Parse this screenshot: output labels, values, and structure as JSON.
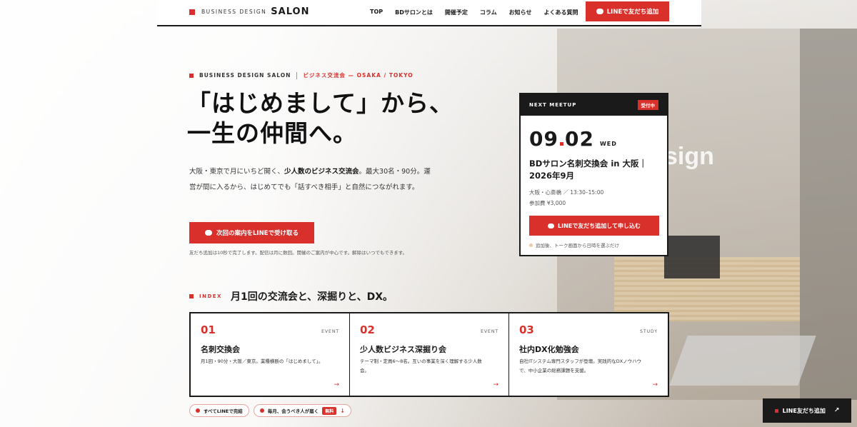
{
  "header": {
    "logo_prefix": "BUSINESS DESIGN",
    "logo_main": "SALON",
    "nav": [
      "TOP",
      "BDサロンとは",
      "開催予定",
      "コラム",
      "お知らせ",
      "よくある質問"
    ],
    "line_button": "LINEで友だち追加"
  },
  "hero": {
    "eyebrow_brand": "BUSINESS DESIGN SALON",
    "eyebrow_tag": "ビジネス交流会 — OSAKA / TOKYO",
    "title_line1": "「はじめまして」から、",
    "title_line2": "一生の仲間へ。",
    "lead_1": "大阪・東京で月にいちど開く、",
    "lead_bold": "少人数のビジネス交流会",
    "lead_2": "。最大30名・90分。運営が間に入るから、はじめてでも「話すべき相手」と自然につながれます。",
    "cta": "次回の案内をLINEで受け取る",
    "note": "友だち追加は10秒で完了します。配信は月に数回。開催のご案内が中心です。解除はいつでもできます。"
  },
  "meetup": {
    "label": "NEXT MEETUP",
    "badge": "受付中",
    "date_month": "09",
    "date_day": "02",
    "weekday": "WED",
    "title": "BDサロン名刺交換会 in 大阪｜2026年9月",
    "place_time": "大阪・心斎橋 ／ 13:30–15:00",
    "fee": "参加費 ¥3,000",
    "apply": "LINEで友だち追加して申し込む",
    "sub": "追加後、トーク画面から日時を選ぶだけ"
  },
  "index": {
    "label": "INDEX",
    "heading": "月1回の交流会と、深掘りと、DX。",
    "items": [
      {
        "num": "01",
        "kind": "EVENT",
        "title": "名刺交換会",
        "desc": "月1回・90分・大阪／東京。業種横断の「はじめまして」。"
      },
      {
        "num": "02",
        "kind": "EVENT",
        "title": "少人数ビジネス深掘り会",
        "desc": "テーマ制・定員6〜8名。互いの事業を深く理解する少人数会。"
      },
      {
        "num": "03",
        "kind": "STUDY",
        "title": "社内DX化勉強会",
        "desc": "自社ITシステム専門スタッフが登壇。実践的なDXノウハウで、中小企業の総務課題を支援。"
      }
    ]
  },
  "pills": {
    "p1": "すべてLINEで完結",
    "p2": "毎月、会うべき人が届く",
    "p2_badge": "無料"
  },
  "float_button": "LINE友だち追加",
  "colors": {
    "accent": "#d9302c",
    "dark": "#1a1a1a"
  }
}
